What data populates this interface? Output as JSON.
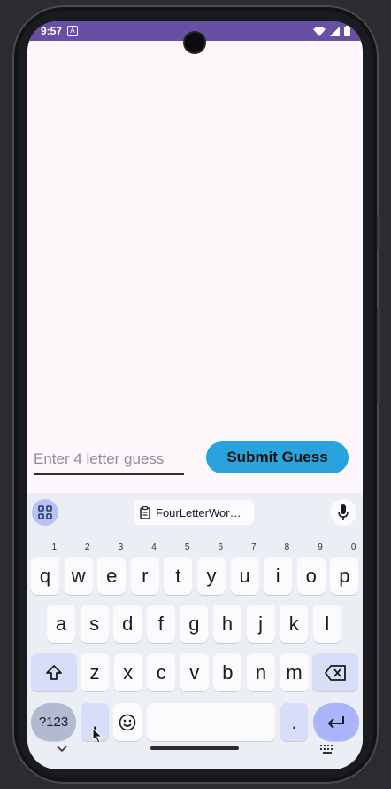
{
  "status_bar": {
    "time": "9:57",
    "a_badge": "A"
  },
  "guess_form": {
    "placeholder": "Enter 4 letter guess",
    "value": "",
    "submit_label": "Submit Guess"
  },
  "keyboard": {
    "clipboard_chip": "FourLetterWor…",
    "row1": [
      {
        "k": "q",
        "h": "1"
      },
      {
        "k": "w",
        "h": "2"
      },
      {
        "k": "e",
        "h": "3"
      },
      {
        "k": "r",
        "h": "4"
      },
      {
        "k": "t",
        "h": "5"
      },
      {
        "k": "y",
        "h": "6"
      },
      {
        "k": "u",
        "h": "7"
      },
      {
        "k": "i",
        "h": "8"
      },
      {
        "k": "o",
        "h": "9"
      },
      {
        "k": "p",
        "h": "0"
      }
    ],
    "row2": [
      "a",
      "s",
      "d",
      "f",
      "g",
      "h",
      "j",
      "k",
      "l"
    ],
    "row3": [
      "z",
      "x",
      "c",
      "v",
      "b",
      "n",
      "m"
    ],
    "symbols_label": "?123",
    "comma": ",",
    "period": "."
  },
  "colors": {
    "status_bar": "#6750a4",
    "background": "#fdf6fb",
    "submit_button": "#29a3dc",
    "keyboard": "#eceef6",
    "function_key": "#d8def7",
    "enter_key": "#a9b4fb"
  }
}
